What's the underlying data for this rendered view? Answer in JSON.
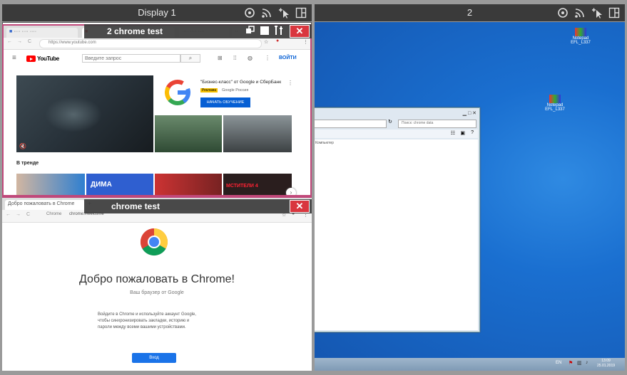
{
  "display1": {
    "title": "Display 1"
  },
  "display2": {
    "title": "2"
  },
  "window_top": {
    "title": "2 chrome test",
    "close": "✕"
  },
  "window_bottom": {
    "title": "chrome test",
    "close": "✕"
  },
  "yt_browser": {
    "url": "https://www.youtube.com",
    "logo": "YouTube",
    "search_placeholder": "Введите запрос",
    "signin": "ВОЙТИ",
    "ad_title": "\"Бизнес-класс\" от Google и СберБанк",
    "ad_badge": "Реклама",
    "ad_brand": "Google Россия",
    "ad_button": "НАЧАТЬ ОБУЧЕНИЕ",
    "trending_label": "В тренде",
    "trend_titles": [
      "ДИМА",
      "МСТИТЕЛИ 4"
    ]
  },
  "chrome_browser": {
    "tab_title": "Добро пожаловать в Chrome",
    "url_label": "Chrome",
    "url_path": "chrome://welcome",
    "heading": "Добро пожаловать в Chrome!",
    "subheading": "Ваш браузер от Google",
    "body": "Войдите в Chrome и используйте аккаунт Google, чтобы синхронизировать закладки, историю и пароли между всеми вашими устройствами.",
    "button": "Вход"
  },
  "desktop2": {
    "icons": [
      "Notepad EFL_L337",
      "Notepad EFL_L337"
    ],
    "explorer_search": "Поиск: chrome data",
    "explorer_sidebar": "Компьютер",
    "clock_time": "13:09",
    "clock_date": "25.01.2019",
    "tray_lang": "EN"
  },
  "colors": {
    "accent_close": "#d9363e",
    "win_blue": "#1a6fd0",
    "yt_red": "#ff0000",
    "chrome_btn": "#1a73e8"
  }
}
